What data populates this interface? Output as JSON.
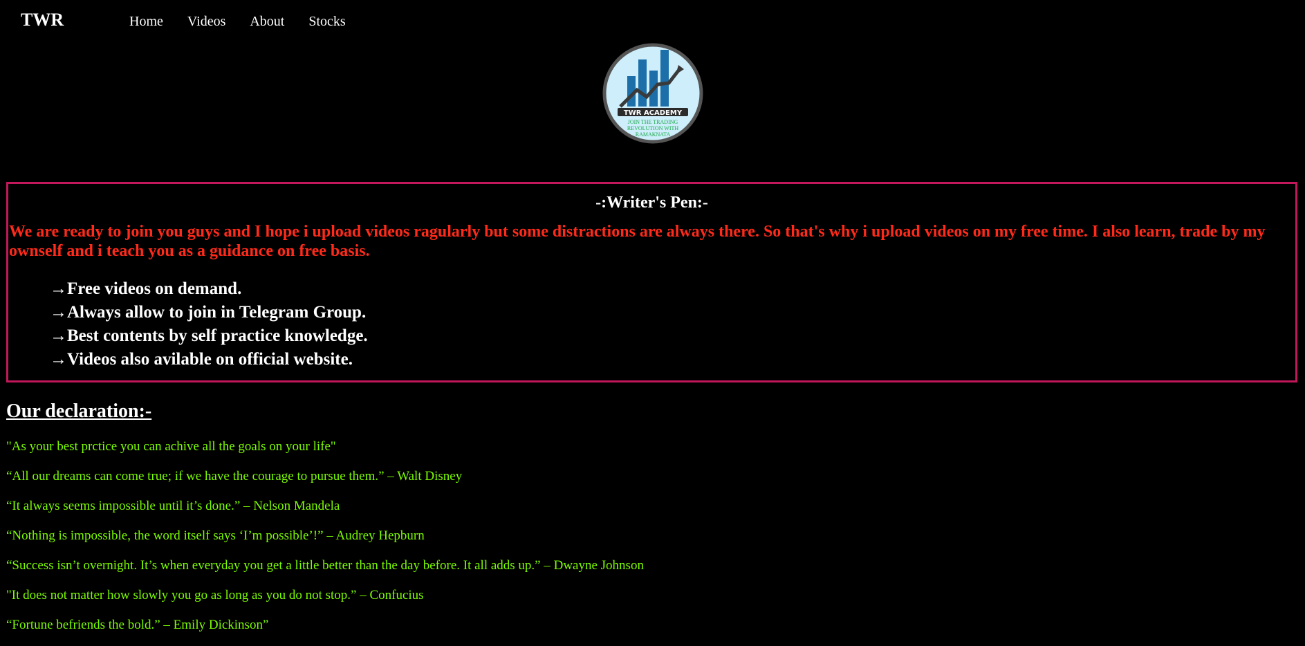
{
  "navbar": {
    "brand": "TWR",
    "links": [
      "Home",
      "Videos",
      "About",
      "Stocks"
    ]
  },
  "logo": {
    "badge_text": "TWR ACADEMY",
    "tagline_1": "JOIN THE TRADING",
    "tagline_2": "REVOLUTION WITH",
    "tagline_3": "RAMAKNATA"
  },
  "writer": {
    "title": "-:Writer's Pen:-",
    "body": "We are ready to join you guys and I hope i upload videos ragularly but some distractions are always there. So that's why i upload videos on my free time. I also learn, trade by my ownself and i teach you as a guidance on free basis.",
    "features": [
      "→Free videos on demand.",
      "→Always allow to join in Telegram Group.",
      "→Best contents by self practice knowledge.",
      "→Videos also avilable on official website."
    ]
  },
  "declaration": {
    "heading": "Our declaration:-",
    "quotes": [
      "\"As your best prctice you can achive all the goals on your life\"",
      "“All our dreams can come true; if we have the courage to pursue them.” – Walt Disney",
      "“It always seems impossible until it’s done.” – Nelson Mandela",
      "“Nothing is impossible, the word itself says ‘I’m possible’!” – Audrey Hepburn",
      "“Success isn’t overnight. It’s when everyday you get a little better than the day before. It all adds up.” – Dwayne Johnson",
      "\"It does not matter how slowly you go as long as you do not stop.” – Confucius",
      "“Fortune befriends the bold.” – Emily Dickinson”"
    ]
  },
  "colors": {
    "background": "#000000",
    "box_border": "#c2185b",
    "writer_body": "#ff2a1a",
    "quotes": "#7cfc00",
    "logo_bg": "#cdeefa",
    "logo_bars": "#1c6fa8"
  }
}
